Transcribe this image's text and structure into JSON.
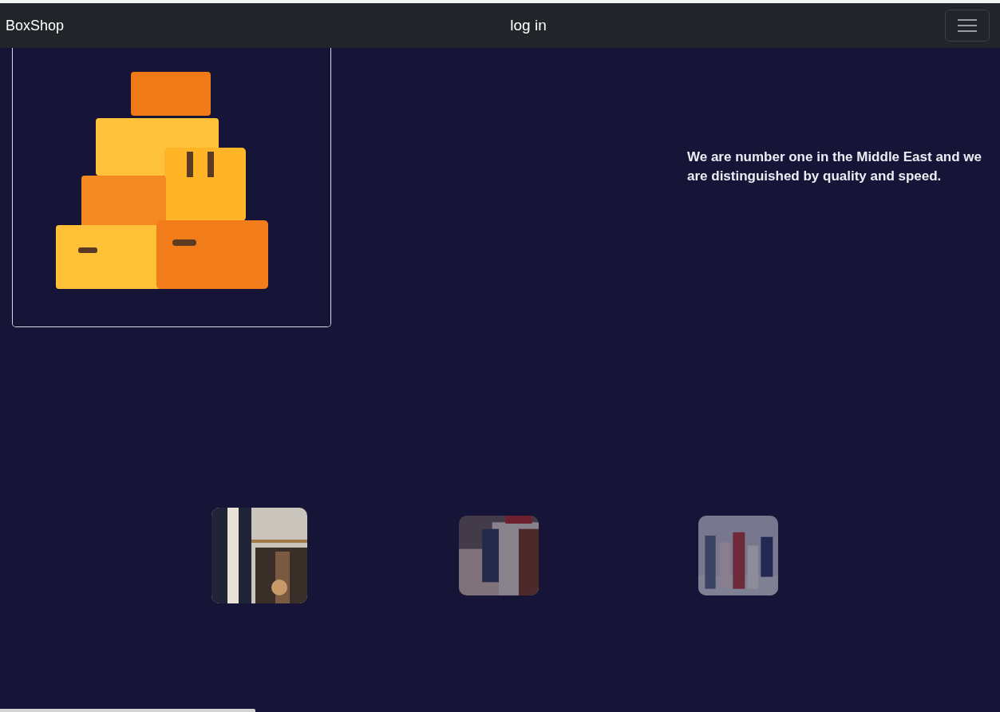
{
  "navbar": {
    "brand": "BoxShop",
    "link": "log in"
  },
  "hero": {
    "image": {
      "kind": "picture"
    },
    "tagline": "We are number one in the Middle East and we are distinguished by quality and speed."
  },
  "thumbnails": [
    {
      "kind": "picture",
      "selected": true
    },
    {
      "kind": "picture",
      "selected": false
    },
    {
      "kind": "picture",
      "selected": false
    }
  ]
}
